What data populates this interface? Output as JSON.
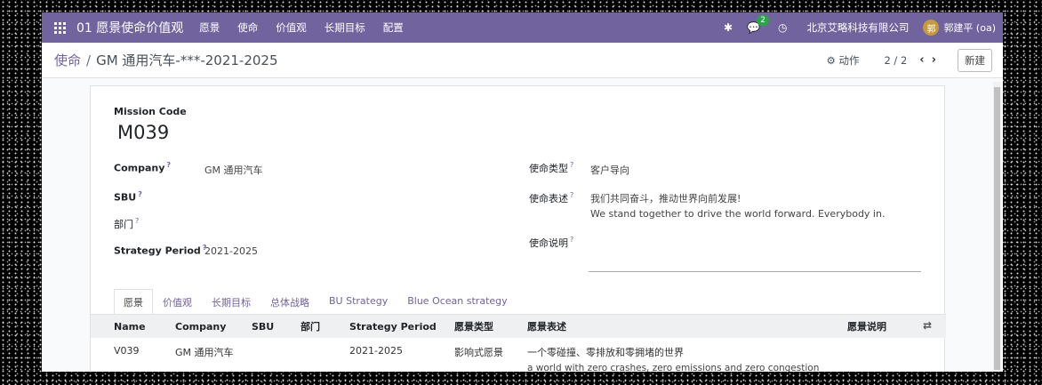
{
  "navbar": {
    "brand": "01 愿景使命价值观",
    "menu": [
      "愿景",
      "使命",
      "价值观",
      "长期目标",
      "配置"
    ],
    "chat_badge": "2",
    "company": "北京艾略科技有限公司",
    "avatar_initial": "郭",
    "user": "郭建平 (oa)"
  },
  "control": {
    "breadcrumb_parent": "使命",
    "breadcrumb_sep": "/",
    "breadcrumb_current": "GM 通用汽车-***-2021-2025",
    "action_label": "动作",
    "pager": "2 / 2",
    "new_label": "新建"
  },
  "form": {
    "mission_code_label": "Mission Code",
    "mission_code": "M039",
    "left": {
      "company_label": "Company",
      "company_value": "GM 通用汽车",
      "sbu_label": "SBU",
      "dept_label": "部门",
      "period_label": "Strategy Period",
      "period_value": "2021-2025"
    },
    "right": {
      "type_label": "使命类型",
      "type_value": "客户导向",
      "statement_label": "使命表述",
      "statement_cn": "我们共同奋斗，推动世界向前发展!",
      "statement_en": "We stand together to drive the world forward. Everybody in.",
      "explain_label": "使命说明"
    },
    "help_mark": "?"
  },
  "tabs": [
    "愿景",
    "价值观",
    "长期目标",
    "总体战略",
    "BU Strategy",
    "Blue Ocean strategy"
  ],
  "table": {
    "headers": [
      "Name",
      "Company",
      "SBU",
      "部门",
      "Strategy Period",
      "愿景类型",
      "愿景表述",
      "愿景说明"
    ],
    "rows": [
      {
        "name": "V039",
        "company": "GM 通用汽车",
        "sbu": "",
        "dept": "",
        "period": "2021-2025",
        "type": "影响式愿景",
        "statement_cn": "一个零碰撞、零排放和零拥堵的世界",
        "statement_en": "a world with zero crashes, zero emissions and zero congestion",
        "explain": ""
      }
    ]
  }
}
